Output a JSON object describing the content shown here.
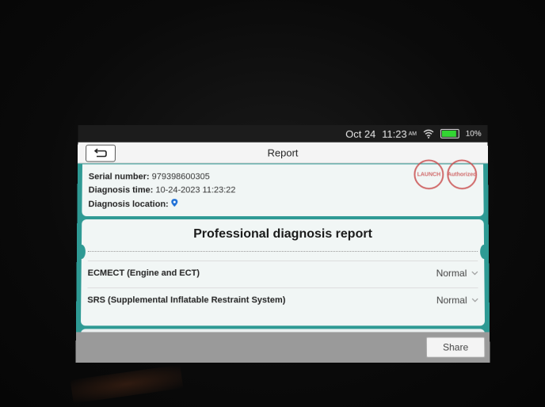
{
  "status_bar": {
    "date": "Oct 24",
    "time": "11:23",
    "ampm": "AM",
    "battery": "10%"
  },
  "header": {
    "title": "Report"
  },
  "info": {
    "serial_label": "Serial number:",
    "serial_value": "979398600305",
    "diag_time_label": "Diagnosis time:",
    "diag_time_value": "10-24-2023 11:23:22",
    "diag_location_label": "Diagnosis location:"
  },
  "stamps": {
    "stamp1": "LAUNCH",
    "stamp2": "Authorized"
  },
  "report": {
    "title": "Professional diagnosis report",
    "rows": [
      {
        "system": "ECMECT (Engine and ECT)",
        "status": "Normal"
      },
      {
        "system": "SRS (Supplemental Inflatable Restraint System)",
        "status": "Normal"
      }
    ]
  },
  "footer": {
    "share_label": "Share"
  },
  "colors": {
    "teal": "#2e9a94",
    "battery_green": "#33d633",
    "stamp_red": "#c94848"
  }
}
